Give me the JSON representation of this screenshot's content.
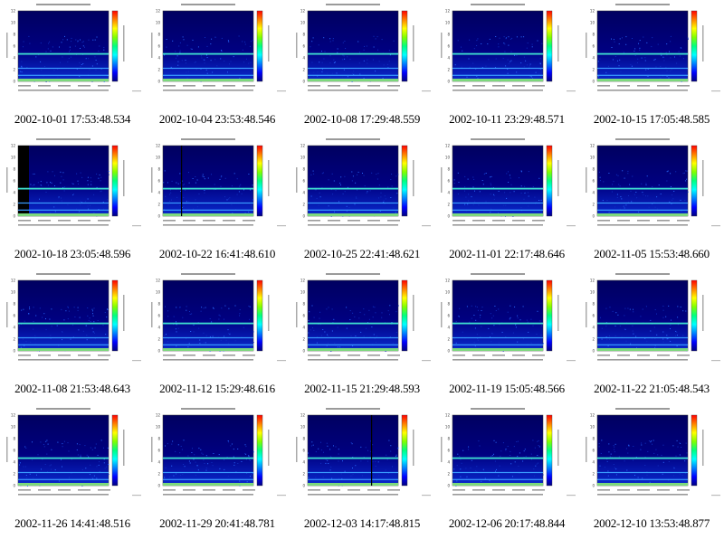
{
  "captions": [
    "2002-10-01 17:53:48.534",
    "2002-10-04 23:53:48.546",
    "2002-10-08 17:29:48.559",
    "2002-10-11 23:29:48.571",
    "2002-10-15 17:05:48.585",
    "2002-10-18 23:05:48.596",
    "2002-10-22 16:41:48.610",
    "2002-10-25 22:41:48.621",
    "2002-11-01 22:17:48.646",
    "2002-11-05 15:53:48.660",
    "2002-11-08 21:53:48.643",
    "2002-11-12 15:29:48.616",
    "2002-11-15 21:29:48.593",
    "2002-11-19 15:05:48.566",
    "2002-11-22 21:05:48.543",
    "2002-11-26 14:41:48.516",
    "2002-11-29 20:41:48.781",
    "2002-12-03 14:17:48.815",
    "2002-12-06 20:17:48.844",
    "2002-12-10 13:53:48.877"
  ],
  "chart_data": [
    {
      "type": "heatmap",
      "time_label": "2002-10-01 17:53:48.534",
      "y_ticks": [
        "0",
        "2",
        "4",
        "6",
        "8",
        "10",
        "12"
      ],
      "ylim": [
        0,
        12
      ],
      "colorscale": "rainbow",
      "bands_y": [
        1.0,
        2.2,
        4.7
      ],
      "dark_start_fraction": 0,
      "vertical_lines": []
    },
    {
      "type": "heatmap",
      "time_label": "2002-10-04 23:53:48.546",
      "y_ticks": [
        "0",
        "2",
        "4",
        "6",
        "8",
        "10",
        "12"
      ],
      "ylim": [
        0,
        12
      ],
      "colorscale": "rainbow",
      "bands_y": [
        1.0,
        2.2,
        4.7
      ],
      "dark_start_fraction": 0,
      "vertical_lines": []
    },
    {
      "type": "heatmap",
      "time_label": "2002-10-08 17:29:48.559",
      "y_ticks": [
        "0",
        "2",
        "4",
        "6",
        "8",
        "10",
        "12"
      ],
      "ylim": [
        0,
        12
      ],
      "colorscale": "rainbow",
      "bands_y": [
        1.0,
        2.2,
        4.7
      ],
      "dark_start_fraction": 0,
      "vertical_lines": []
    },
    {
      "type": "heatmap",
      "time_label": "2002-10-11 23:29:48.571",
      "y_ticks": [
        "0",
        "2",
        "4",
        "6",
        "8",
        "10",
        "12"
      ],
      "ylim": [
        0,
        12
      ],
      "colorscale": "rainbow",
      "bands_y": [
        1.0,
        2.2,
        4.7
      ],
      "dark_start_fraction": 0,
      "vertical_lines": []
    },
    {
      "type": "heatmap",
      "time_label": "2002-10-15 17:05:48.585",
      "y_ticks": [
        "0",
        "2",
        "4",
        "6",
        "8",
        "10",
        "12"
      ],
      "ylim": [
        0,
        12
      ],
      "colorscale": "rainbow",
      "bands_y": [
        1.0,
        2.2,
        4.7
      ],
      "dark_start_fraction": 0,
      "vertical_lines": []
    },
    {
      "type": "heatmap",
      "time_label": "2002-10-18 23:05:48.596",
      "y_ticks": [
        "0",
        "2",
        "4",
        "6",
        "8",
        "10",
        "12"
      ],
      "ylim": [
        0,
        12
      ],
      "colorscale": "rainbow",
      "bands_y": [
        1.0,
        2.2,
        4.7
      ],
      "dark_start_fraction": 0.12,
      "vertical_lines": []
    },
    {
      "type": "heatmap",
      "time_label": "2002-10-22 16:41:48.610",
      "y_ticks": [
        "0",
        "2",
        "4",
        "6",
        "8",
        "10",
        "12"
      ],
      "ylim": [
        0,
        12
      ],
      "colorscale": "rainbow",
      "bands_y": [
        1.0,
        2.2,
        4.7
      ],
      "dark_start_fraction": 0,
      "vertical_lines": [
        0.2
      ]
    },
    {
      "type": "heatmap",
      "time_label": "2002-10-25 22:41:48.621",
      "y_ticks": [
        "0",
        "2",
        "4",
        "6",
        "8",
        "10",
        "12"
      ],
      "ylim": [
        0,
        12
      ],
      "colorscale": "rainbow",
      "bands_y": [
        1.0,
        2.2,
        4.7
      ],
      "dark_start_fraction": 0,
      "vertical_lines": []
    },
    {
      "type": "heatmap",
      "time_label": "2002-11-01 22:17:48.646",
      "y_ticks": [
        "0",
        "2",
        "4",
        "6",
        "8",
        "10",
        "12"
      ],
      "ylim": [
        0,
        12
      ],
      "colorscale": "rainbow",
      "bands_y": [
        1.0,
        2.2,
        4.7
      ],
      "dark_start_fraction": 0,
      "vertical_lines": []
    },
    {
      "type": "heatmap",
      "time_label": "2002-11-05 15:53:48.660",
      "y_ticks": [
        "0",
        "2",
        "4",
        "6",
        "8",
        "10",
        "12"
      ],
      "ylim": [
        0,
        12
      ],
      "colorscale": "rainbow",
      "bands_y": [
        1.0,
        2.2,
        4.7
      ],
      "dark_start_fraction": 0,
      "vertical_lines": []
    },
    {
      "type": "heatmap",
      "time_label": "2002-11-08 21:53:48.643",
      "y_ticks": [
        "0",
        "2",
        "4",
        "6",
        "8",
        "10",
        "12"
      ],
      "ylim": [
        0,
        12
      ],
      "colorscale": "rainbow",
      "bands_y": [
        1.0,
        2.2,
        4.7
      ],
      "dark_start_fraction": 0,
      "vertical_lines": []
    },
    {
      "type": "heatmap",
      "time_label": "2002-11-12 15:29:48.616",
      "y_ticks": [
        "0",
        "2",
        "4",
        "6",
        "8",
        "10",
        "12"
      ],
      "ylim": [
        0,
        12
      ],
      "colorscale": "rainbow",
      "bands_y": [
        1.0,
        2.2,
        4.7
      ],
      "dark_start_fraction": 0,
      "vertical_lines": []
    },
    {
      "type": "heatmap",
      "time_label": "2002-11-15 21:29:48.593",
      "y_ticks": [
        "0",
        "2",
        "4",
        "6",
        "8",
        "10",
        "12"
      ],
      "ylim": [
        0,
        12
      ],
      "colorscale": "rainbow",
      "bands_y": [
        1.0,
        2.2,
        4.7
      ],
      "dark_start_fraction": 0,
      "vertical_lines": []
    },
    {
      "type": "heatmap",
      "time_label": "2002-11-19 15:05:48.566",
      "y_ticks": [
        "0",
        "2",
        "4",
        "6",
        "8",
        "10",
        "12"
      ],
      "ylim": [
        0,
        12
      ],
      "colorscale": "rainbow",
      "bands_y": [
        1.0,
        2.2,
        4.7
      ],
      "dark_start_fraction": 0,
      "vertical_lines": []
    },
    {
      "type": "heatmap",
      "time_label": "2002-11-22 21:05:48.543",
      "y_ticks": [
        "0",
        "2",
        "4",
        "6",
        "8",
        "10",
        "12"
      ],
      "ylim": [
        0,
        12
      ],
      "colorscale": "rainbow",
      "bands_y": [
        1.0,
        2.2,
        4.7
      ],
      "dark_start_fraction": 0,
      "vertical_lines": []
    },
    {
      "type": "heatmap",
      "time_label": "2002-11-26 14:41:48.516",
      "y_ticks": [
        "0",
        "2",
        "4",
        "6",
        "8",
        "10",
        "12"
      ],
      "ylim": [
        0,
        12
      ],
      "colorscale": "rainbow",
      "bands_y": [
        1.0,
        2.2,
        4.7
      ],
      "dark_start_fraction": 0,
      "vertical_lines": []
    },
    {
      "type": "heatmap",
      "time_label": "2002-11-29 20:41:48.781",
      "y_ticks": [
        "0",
        "2",
        "4",
        "6",
        "8",
        "10",
        "12"
      ],
      "ylim": [
        0,
        12
      ],
      "colorscale": "rainbow",
      "bands_y": [
        1.0,
        2.2,
        4.7
      ],
      "dark_start_fraction": 0,
      "vertical_lines": []
    },
    {
      "type": "heatmap",
      "time_label": "2002-12-03 14:17:48.815",
      "y_ticks": [
        "0",
        "2",
        "4",
        "6",
        "8",
        "10",
        "12"
      ],
      "ylim": [
        0,
        12
      ],
      "colorscale": "rainbow",
      "bands_y": [
        1.0,
        2.2,
        4.7
      ],
      "dark_start_fraction": 0,
      "vertical_lines": [
        0.7
      ]
    },
    {
      "type": "heatmap",
      "time_label": "2002-12-06 20:17:48.844",
      "y_ticks": [
        "0",
        "2",
        "4",
        "6",
        "8",
        "10",
        "12"
      ],
      "ylim": [
        0,
        12
      ],
      "colorscale": "rainbow",
      "bands_y": [
        1.0,
        2.2,
        4.7
      ],
      "dark_start_fraction": 0,
      "vertical_lines": []
    },
    {
      "type": "heatmap",
      "time_label": "2002-12-10 13:53:48.877",
      "y_ticks": [
        "0",
        "2",
        "4",
        "6",
        "8",
        "10",
        "12"
      ],
      "ylim": [
        0,
        12
      ],
      "colorscale": "rainbow",
      "bands_y": [
        1.0,
        2.2,
        4.7
      ],
      "dark_start_fraction": 0,
      "vertical_lines": []
    }
  ]
}
